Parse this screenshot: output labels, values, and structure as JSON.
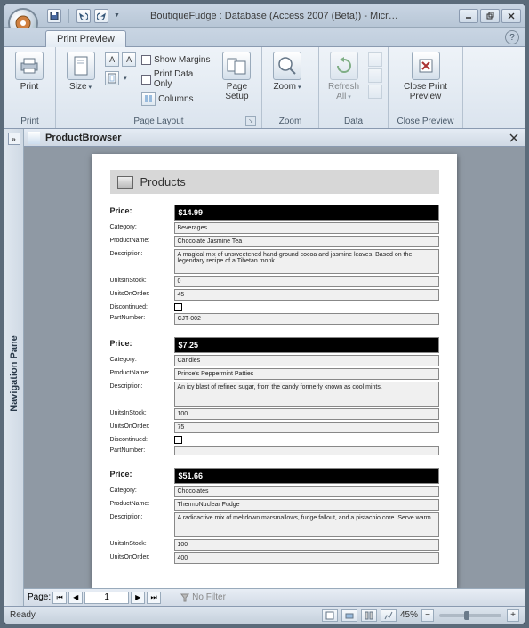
{
  "title": "BoutiqueFudge : Database (Access 2007 (Beta)) - Micr…",
  "qat": {
    "save": "save",
    "undo": "undo",
    "redo": "redo"
  },
  "tab": {
    "label": "Print Preview"
  },
  "ribbon": {
    "print": {
      "label": "Print",
      "group": "Print"
    },
    "size": {
      "label": "Size"
    },
    "margins_chk": "Show Margins",
    "dataonly_chk": "Print Data Only",
    "columns": "Columns",
    "landscape": "A",
    "portrait": "A",
    "pagesetup": {
      "label": "Page\nSetup"
    },
    "pagelayout_group": "Page Layout",
    "zoom": {
      "label": "Zoom",
      "group": "Zoom"
    },
    "refresh": {
      "label": "Refresh\nAll"
    },
    "data_group": "Data",
    "close": {
      "label": "Close Print\nPreview",
      "group": "Close Preview"
    }
  },
  "navpane": {
    "label": "Navigation Pane",
    "toggle": "»"
  },
  "object": {
    "name": "ProductBrowser"
  },
  "report": {
    "title": "Products",
    "records": [
      {
        "price": "$14.99",
        "category": "Beverages",
        "productname": "Chocolate Jasmine Tea",
        "description": "A magical mix of unsweetened hand-ground cocoa and jasmine leaves. Based on the legendary recipe of a Tibetan monk.",
        "unitsinstock": "0",
        "unitsonorder": "45",
        "discontinued": false,
        "partnumber": "CJT-002"
      },
      {
        "price": "$7.25",
        "category": "Candies",
        "productname": "Prince's Peppermint Patties",
        "description": "An icy blast of refined sugar, from the candy formerly known as cool mints.",
        "unitsinstock": "100",
        "unitsonorder": "75",
        "discontinued": false,
        "partnumber": ""
      },
      {
        "price": "$51.66",
        "category": "Chocolates",
        "productname": "ThermoNuclear Fudge",
        "description": "A radioactive mix of meltdown marsmallows, fudge fallout, and a pistachio core. Serve warm.",
        "unitsinstock": "100",
        "unitsonorder": "400",
        "discontinued": null,
        "partnumber": null
      }
    ],
    "labels": {
      "price": "Price:",
      "category": "Category:",
      "productname": "ProductName:",
      "description": "Description:",
      "unitsinstock": "UnitsInStock:",
      "unitsonorder": "UnitsOnOrder:",
      "discontinued": "Discontinued:",
      "partnumber": "PartNumber:"
    }
  },
  "pagenav": {
    "label": "Page:",
    "value": "1",
    "nofilter": "No Filter"
  },
  "status": {
    "ready": "Ready",
    "zoom": "45%"
  }
}
